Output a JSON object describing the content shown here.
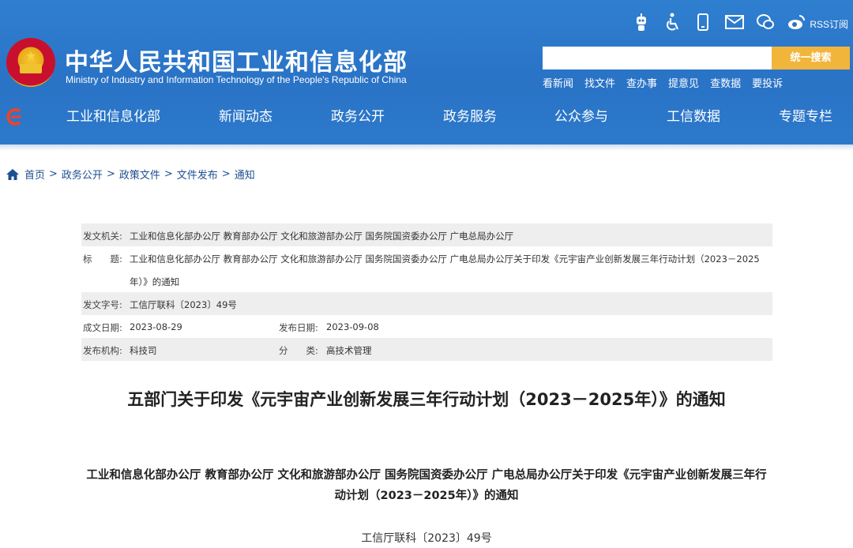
{
  "header": {
    "title_cn": "中华人民共和国工业和信息化部",
    "title_en": "Ministry of Industry and Information Technology of the People's Republic of China",
    "icons": [
      "robot-icon",
      "accessibility-icon",
      "mobile-icon",
      "mail-icon",
      "wechat-icon",
      "weibo-icon"
    ],
    "rss_label": "RSS订阅",
    "search": {
      "placeholder": "",
      "button_label": "统一搜索"
    },
    "quick_links": [
      "看新闻",
      "找文件",
      "查办事",
      "提意见",
      "查数据",
      "要投诉"
    ],
    "colors": {
      "primary": "#2a73c6",
      "search_button": "#f2b53b"
    }
  },
  "nav": {
    "items": [
      "工业和信息化部",
      "新闻动态",
      "政务公开",
      "政务服务",
      "公众参与",
      "工信数据",
      "专题专栏"
    ]
  },
  "breadcrumb": {
    "items": [
      "首页",
      "政务公开",
      "政策文件",
      "文件发布",
      "通知"
    ],
    "separator": ">"
  },
  "meta": {
    "issuer_label": "发文机关:",
    "issuer": "工业和信息化部办公厅 教育部办公厅 文化和旅游部办公厅 国务院国资委办公厅 广电总局办公厅",
    "title_label": "标　　题:",
    "title_line1": "工业和信息化部办公厅 教育部办公厅 文化和旅游部办公厅 国务院国资委办公厅 广电总局办公厅关于印发《元宇宙产业创新发展三年行动计划（2023－2025",
    "title_line2": "年）》的通知",
    "doc_no_label": "发文字号:",
    "doc_no": "工信厅联科〔2023〕49号",
    "written_label": "成文日期:",
    "written_date": "2023-08-29",
    "published_label": "发布日期:",
    "published_date": "2023-09-08",
    "org_label": "发布机构:",
    "org": "科技司",
    "category_label": "分　　类:",
    "category": "高技术管理"
  },
  "document": {
    "title": "五部门关于印发《元宇宙产业创新发展三年行动计划（2023－2025年）》的通知",
    "subtitle": "工业和信息化部办公厅 教育部办公厅 文化和旅游部办公厅 国务院国资委办公厅 广电总局办公厅关于印发《元宇宙产业创新发展三年行动计划（2023－2025年）》的通知",
    "number": "工信厅联科〔2023〕49号"
  }
}
